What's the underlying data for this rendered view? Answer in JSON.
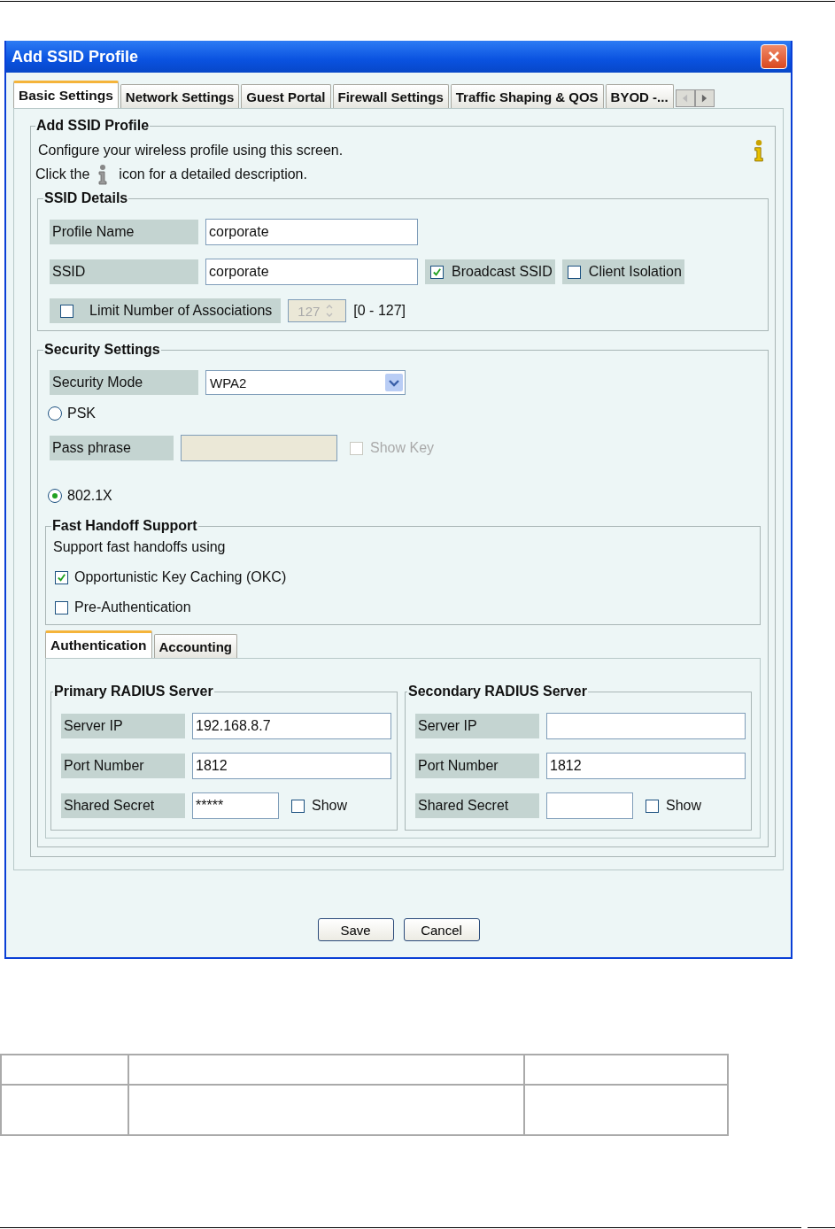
{
  "dialog": {
    "title": "Add SSID Profile"
  },
  "tabs": [
    {
      "label": "Basic Settings",
      "selected": true
    },
    {
      "label": "Network Settings",
      "selected": false
    },
    {
      "label": "Guest Portal",
      "selected": false
    },
    {
      "label": "Firewall Settings",
      "selected": false
    },
    {
      "label": "Traffic Shaping & QOS",
      "selected": false
    },
    {
      "label": "BYOD -...",
      "selected": false
    }
  ],
  "profile": {
    "legend": "Add SSID Profile",
    "intro": "Configure your wireless profile using this screen.",
    "hint_before": "Click the",
    "hint_after": "icon for a detailed description."
  },
  "ssid_details": {
    "legend": "SSID Details",
    "profile_name": {
      "label": "Profile Name",
      "value": "corporate"
    },
    "ssid": {
      "label": "SSID",
      "value": "corporate"
    },
    "broadcast_ssid": {
      "label": "Broadcast SSID",
      "checked": true
    },
    "client_isolation": {
      "label": "Client Isolation",
      "checked": false
    },
    "limit": {
      "label": "Limit Number of Associations",
      "checked": false,
      "value": "127",
      "disabled": true
    },
    "range": "[0 - 127]"
  },
  "security": {
    "legend": "Security Settings",
    "mode_label": "Security Mode",
    "mode_value": "WPA2",
    "psk": {
      "label": "PSK",
      "selected": false
    },
    "passphrase": {
      "label": "Pass phrase",
      "disabled": true
    },
    "show_key": {
      "label": "Show Key",
      "checked": false,
      "disabled": true
    },
    "dot1x": {
      "label": "802.1X",
      "selected": true
    }
  },
  "fast_handoff": {
    "legend": "Fast Handoff Support",
    "intro": "Support fast handoffs using",
    "options": [
      {
        "label": "Opportunistic Key Caching (OKC)",
        "checked": true
      },
      {
        "label": "Pre-Authentication",
        "checked": false
      }
    ]
  },
  "radius_tabs": [
    {
      "label": "Authentication",
      "selected": true
    },
    {
      "label": "Accounting",
      "selected": false
    }
  ],
  "servers": [
    {
      "legend": "Primary RADIUS Server",
      "server_ip": {
        "label": "Server IP",
        "value": "192.168.8.7"
      },
      "port": {
        "label": "Port Number",
        "value": "1812"
      },
      "secret": {
        "label": "Shared Secret",
        "value": "*****"
      },
      "show": {
        "label": "Show",
        "checked": false
      }
    },
    {
      "legend": "Secondary RADIUS Server",
      "server_ip": {
        "label": "Server IP"
      },
      "port": {
        "label": "Port Number",
        "value": "1812"
      },
      "secret": {
        "label": "Shared Secret"
      },
      "show": {
        "label": "Show",
        "checked": false
      }
    }
  ],
  "buttons": [
    "Save",
    "Cancel"
  ]
}
